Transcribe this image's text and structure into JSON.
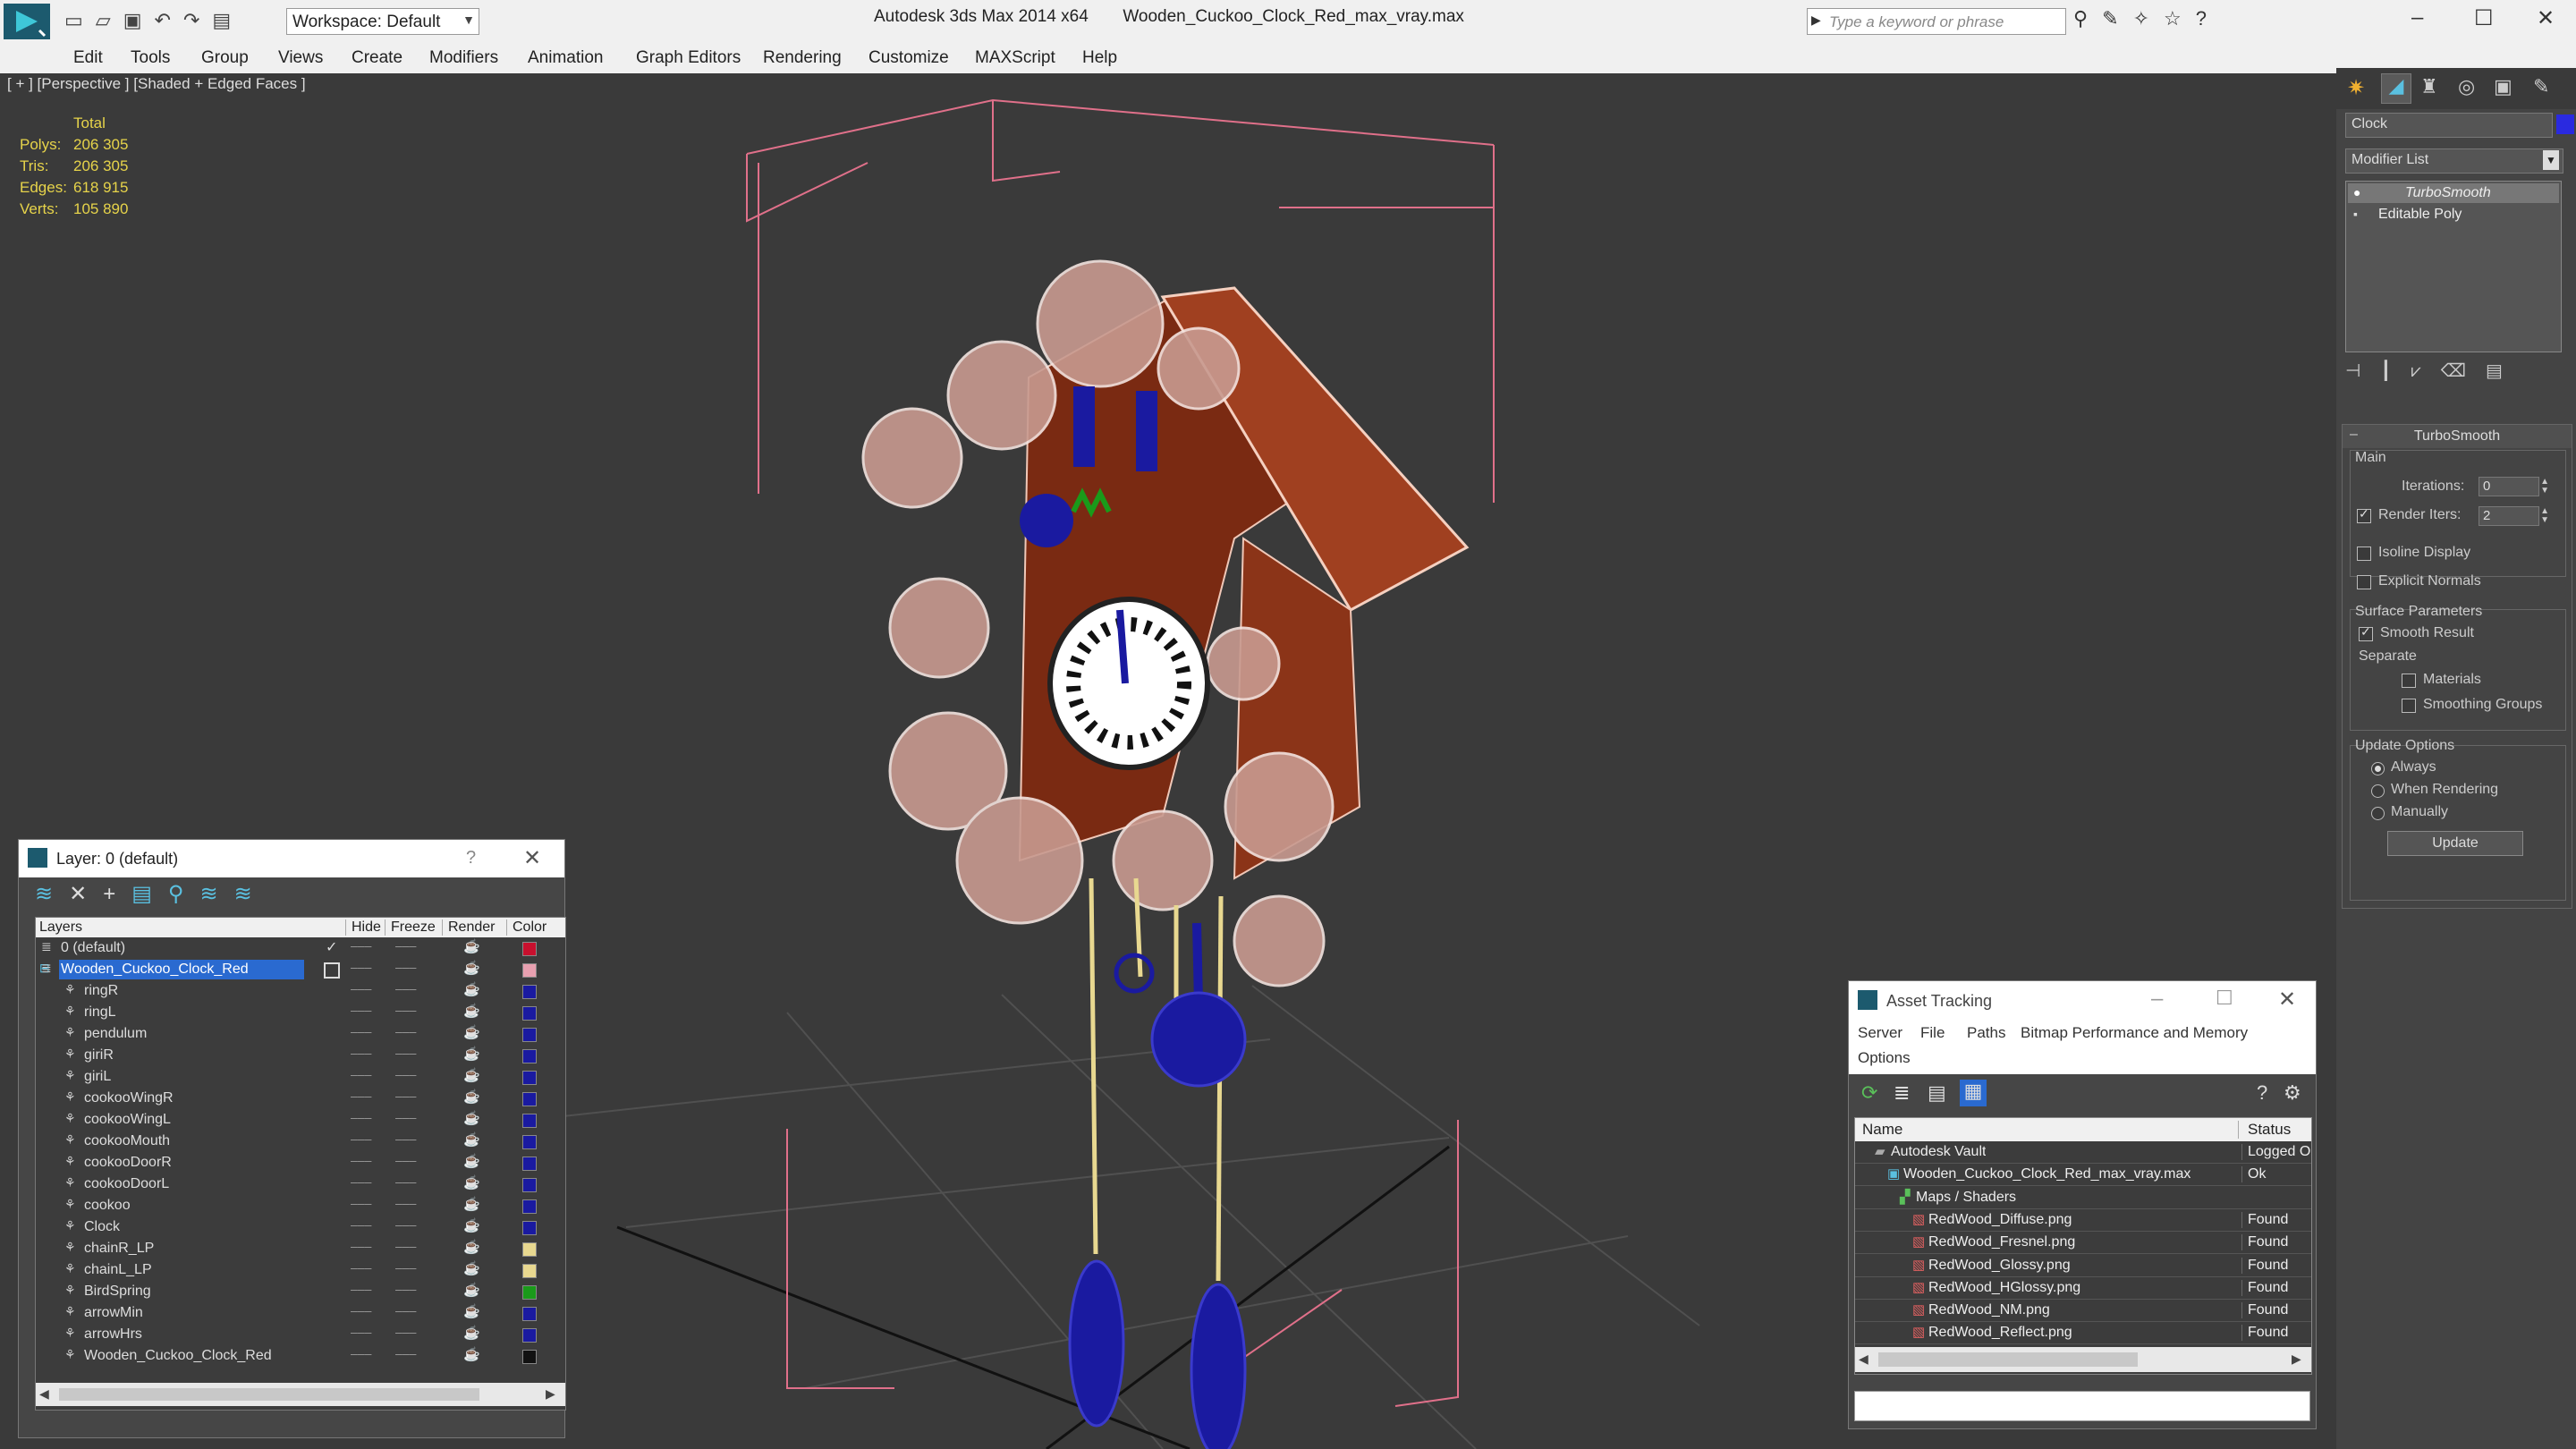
{
  "titlebar": {
    "workspace_label": "Workspace: Default",
    "title_app": "Autodesk 3ds Max  2014 x64",
    "title_file": "Wooden_Cuckoo_Clock_Red_max_vray.max",
    "search_placeholder": "Type a keyword or phrase"
  },
  "menu": [
    "Edit",
    "Tools",
    "Group",
    "Views",
    "Create",
    "Modifiers",
    "Animation",
    "Graph Editors",
    "Rendering",
    "Customize",
    "MAXScript",
    "Help"
  ],
  "viewport": {
    "label": "[ + ] [Perspective ] [Shaded + Edged Faces ]",
    "stats_header": "Total",
    "stats": [
      {
        "label": "Polys:",
        "value": "206 305"
      },
      {
        "label": "Tris:",
        "value": "206 305"
      },
      {
        "label": "Edges:",
        "value": "618 915"
      },
      {
        "label": "Verts:",
        "value": "105 890"
      }
    ]
  },
  "layer_panel": {
    "title": "Layer: 0 (default)",
    "help": "?",
    "columns": [
      "Layers",
      "Hide",
      "Freeze",
      "Render",
      "Color"
    ],
    "rows": [
      {
        "name": "0 (default)",
        "indent": 0,
        "color": "#c8102e",
        "selected": false,
        "current": true
      },
      {
        "name": "Wooden_Cuckoo_Clock_Red",
        "indent": 0,
        "color": "#e8a0b0",
        "selected": true,
        "current": false
      },
      {
        "name": "ringR",
        "indent": 1,
        "color": "#1a1aa0"
      },
      {
        "name": "ringL",
        "indent": 1,
        "color": "#1a1aa0"
      },
      {
        "name": "pendulum",
        "indent": 1,
        "color": "#1a1aa0"
      },
      {
        "name": "giriR",
        "indent": 1,
        "color": "#1a1aa0"
      },
      {
        "name": "giriL",
        "indent": 1,
        "color": "#1a1aa0"
      },
      {
        "name": "cookooWingR",
        "indent": 1,
        "color": "#1a1aa0"
      },
      {
        "name": "cookooWingL",
        "indent": 1,
        "color": "#1a1aa0"
      },
      {
        "name": "cookooMouth",
        "indent": 1,
        "color": "#1a1aa0"
      },
      {
        "name": "cookooDoorR",
        "indent": 1,
        "color": "#1a1aa0"
      },
      {
        "name": "cookooDoorL",
        "indent": 1,
        "color": "#1a1aa0"
      },
      {
        "name": "cookoo",
        "indent": 1,
        "color": "#1a1aa0"
      },
      {
        "name": "Clock",
        "indent": 1,
        "color": "#1a1aa0"
      },
      {
        "name": "chainR_LP",
        "indent": 1,
        "color": "#e8d890"
      },
      {
        "name": "chainL_LP",
        "indent": 1,
        "color": "#e8d890"
      },
      {
        "name": "BirdSpring",
        "indent": 1,
        "color": "#1a9a1a"
      },
      {
        "name": "arrowMin",
        "indent": 1,
        "color": "#1a1aa0"
      },
      {
        "name": "arrowHrs",
        "indent": 1,
        "color": "#1a1aa0"
      },
      {
        "name": "Wooden_Cuckoo_Clock_Red",
        "indent": 1,
        "color": "#111111"
      }
    ]
  },
  "asset_panel": {
    "title": "Asset Tracking",
    "menu": [
      "Server",
      "File",
      "Paths",
      "Bitmap Performance and Memory",
      "Options"
    ],
    "columns": [
      "Name",
      "Status"
    ],
    "rows": [
      {
        "name": "Autodesk Vault",
        "status": "Logged Out",
        "indent": 1,
        "type": "vault"
      },
      {
        "name": "Wooden_Cuckoo_Clock_Red_max_vray.max",
        "status": "Ok",
        "indent": 2,
        "type": "max"
      },
      {
        "name": "Maps / Shaders",
        "status": "",
        "indent": 3,
        "type": "maps"
      },
      {
        "name": "RedWood_Diffuse.png",
        "status": "Found",
        "indent": 4,
        "type": "png"
      },
      {
        "name": "RedWood_Fresnel.png",
        "status": "Found",
        "indent": 4,
        "type": "png"
      },
      {
        "name": "RedWood_Glossy.png",
        "status": "Found",
        "indent": 4,
        "type": "png"
      },
      {
        "name": "RedWood_HGlossy.png",
        "status": "Found",
        "indent": 4,
        "type": "png"
      },
      {
        "name": "RedWood_NM.png",
        "status": "Found",
        "indent": 4,
        "type": "png"
      },
      {
        "name": "RedWood_Reflect.png",
        "status": "Found",
        "indent": 4,
        "type": "png"
      }
    ]
  },
  "command_panel": {
    "object_name": "Clock",
    "object_color": "#2a2ae0",
    "modifier_list_label": "Modifier List",
    "stack": [
      "TurboSmooth",
      "Editable Poly"
    ],
    "rollout_title": "TurboSmooth",
    "main_label": "Main",
    "iterations_label": "Iterations:",
    "iterations_value": "0",
    "render_iters_label": "Render Iters:",
    "render_iters_value": "2",
    "isoline_label": "Isoline Display",
    "explicit_label": "Explicit Normals",
    "surface_label": "Surface Parameters",
    "smooth_label": "Smooth Result",
    "separate_label": "Separate",
    "materials_label": "Materials",
    "smoothing_groups_label": "Smoothing Groups",
    "update_options_label": "Update Options",
    "always_label": "Always",
    "when_rendering_label": "When Rendering",
    "manually_label": "Manually",
    "update_button": "Update"
  }
}
